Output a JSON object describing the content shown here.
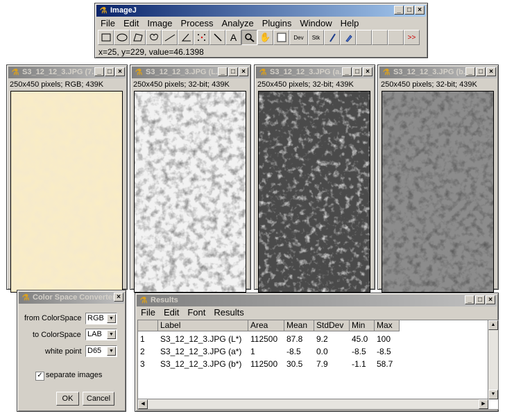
{
  "imagej": {
    "title": "ImageJ",
    "menu": [
      "File",
      "Edit",
      "Image",
      "Process",
      "Analyze",
      "Plugins",
      "Window",
      "Help"
    ],
    "status": "x=25, y=229, value=46.1398",
    "tools": [
      "rectangle-tool",
      "oval-tool",
      "polygon-tool",
      "freehand-tool",
      "line-tool",
      "angle-tool",
      "point-tool",
      "wand-tool",
      "text-tool",
      "magnifier-tool",
      "hand-tool",
      "color-picker-tool",
      "dev-menu-tool",
      "stk-menu-tool",
      "brush-tool",
      "dropper-tool",
      "blank-1",
      "blank-2",
      "blank-3",
      "more-tools"
    ],
    "tool_labels": {
      "text": "A",
      "dev": "Dev",
      "stk": "Stk",
      "more": ">>"
    }
  },
  "image_windows": [
    {
      "title": "S3_12_12_3.JPG (7...",
      "info": "250x450 pixels; RGB; 439K",
      "active": false
    },
    {
      "title": "S3_12_12_3.JPG (L...",
      "info": "250x450 pixels; 32-bit; 439K",
      "active": false
    },
    {
      "title": "S3_12_12_3.JPG (a...",
      "info": "250x450 pixels; 32-bit; 439K",
      "active": false
    },
    {
      "title": "S3_12_12_3.JPG (b...",
      "info": "250x450 pixels; 32-bit; 439K",
      "active": false
    }
  ],
  "converter": {
    "title": "Color Space Converter ...",
    "from_label": "from ColorSpace",
    "from_value": "RGB",
    "to_label": "to ColorSpace",
    "to_value": "LAB",
    "white_label": "white point",
    "white_value": "D65",
    "separate_label": "separate images",
    "separate_checked": true,
    "ok": "OK",
    "cancel": "Cancel"
  },
  "results": {
    "title": "Results",
    "menu": [
      "File",
      "Edit",
      "Font",
      "Results"
    ],
    "columns": [
      "",
      "Label",
      "Area",
      "Mean",
      "StdDev",
      "Min",
      "Max"
    ],
    "rows": [
      [
        "1",
        "S3_12_12_3.JPG (L*)",
        "112500",
        "87.8",
        "9.2",
        "45.0",
        "100"
      ],
      [
        "2",
        "S3_12_12_3.JPG (a*)",
        "1",
        "-8.5",
        "0.0",
        "-8.5",
        "-8.5"
      ],
      [
        "3",
        "S3_12_12_3.JPG (b*)",
        "112500",
        "30.5",
        "7.9",
        "-1.1",
        "58.7"
      ]
    ]
  },
  "colors": {
    "active_title": "#0a246a",
    "inactive_title": "#808080",
    "window_bg": "#d4d0c8"
  }
}
